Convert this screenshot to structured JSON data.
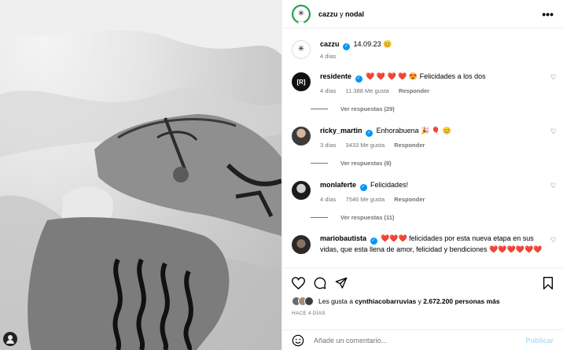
{
  "header": {
    "user1": "cazzu",
    "conjunction": "y",
    "user2": "nodal",
    "more_label": "•••"
  },
  "caption": {
    "username": "cazzu",
    "verified_mark": "✓",
    "text": "14.09.23",
    "time": "4 días"
  },
  "comments": [
    {
      "username": "residente",
      "avatar_text": "[R]",
      "text": "❤️ ❤️ ❤️ ❤️ 😍 Felicidades a los dos",
      "time": "4 días",
      "likes": "11.388 Me gusta",
      "reply": "Responder",
      "replies": "Ver respuestas (29)"
    },
    {
      "username": "ricky_martin",
      "text": "Enhorabuena 🎉 🎈 😊",
      "time": "3 días",
      "likes": "3433 Me gusta",
      "reply": "Responder",
      "replies": "Ver respuestas (8)"
    },
    {
      "username": "monlaferte",
      "text": "Felicidades!",
      "time": "4 días",
      "likes": "7546 Me gusta",
      "reply": "Responder",
      "replies": "Ver respuestas (11)"
    },
    {
      "username": "mariobautista",
      "text": "❤️❤️❤️ felicidades por esta nueva etapa en sus vidas, que esta llena de amor, felicidad y bendiciones ❤️❤️❤️❤️❤️❤️"
    }
  ],
  "likes": {
    "prefix": "Les gusta a",
    "user": "cynthiacobarruvias",
    "middle": "y",
    "count": "2.672.200 personas más"
  },
  "time_ago": "HACE 4 DÍAS",
  "add_comment": {
    "placeholder": "Añade un comentario...",
    "publish": "Publicar"
  },
  "colors": {
    "verified": "#0095f6",
    "story_ring": "#1aa34a",
    "publish_disabled": "#b2dffc"
  }
}
